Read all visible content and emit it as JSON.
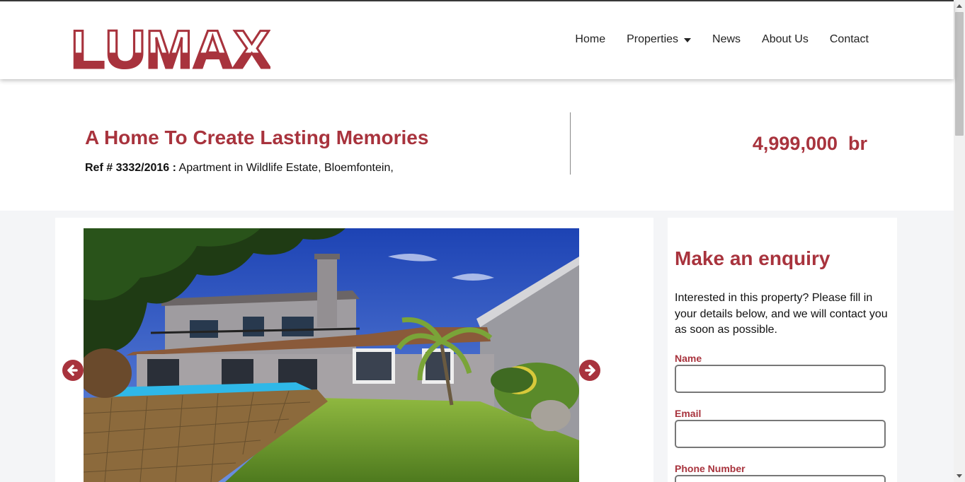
{
  "brand": {
    "logo_text": "LUMAX",
    "color": "#a8333d"
  },
  "nav": {
    "items": [
      {
        "label": "Home"
      },
      {
        "label": "Properties",
        "has_dropdown": true
      },
      {
        "label": "News"
      },
      {
        "label": "About Us"
      },
      {
        "label": "Contact"
      }
    ]
  },
  "property": {
    "title": "A Home To Create Lasting Memories",
    "ref_label": "Ref # 3332/2016 :",
    "ref_detail": " Apartment in Wildlife Estate, Bloemfontein,",
    "price": "4,999,000  br"
  },
  "gallery": {
    "prev_icon": "arrow-left-circle-icon",
    "next_icon": "arrow-right-circle-icon"
  },
  "enquiry": {
    "title": "Make an enquiry",
    "description": "Interested in this property? Please fill in your details below, and we will contact you as soon as possible.",
    "fields": [
      {
        "label": "Name",
        "value": ""
      },
      {
        "label": "Email",
        "value": ""
      },
      {
        "label": "Phone Number",
        "value": ""
      }
    ]
  }
}
